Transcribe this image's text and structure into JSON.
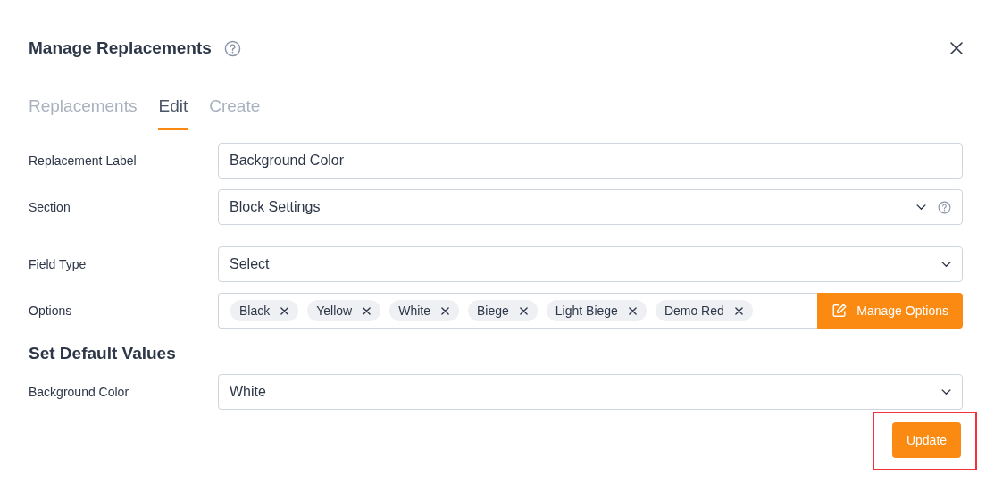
{
  "dialog": {
    "title": "Manage Replacements",
    "has_help": true
  },
  "tabs": [
    {
      "label": "Replacements",
      "selected": false
    },
    {
      "label": "Edit",
      "selected": true
    },
    {
      "label": "Create",
      "selected": false
    }
  ],
  "fields": [
    {
      "kind": "text",
      "label": "Replacement Label",
      "value": "Background Color"
    },
    {
      "kind": "select",
      "label": "Section",
      "value": "Block Settings",
      "has_help": true
    },
    {
      "kind": "select",
      "label": "Field Type",
      "value": "Select",
      "has_help": false
    },
    {
      "kind": "tags",
      "label": "Options",
      "tags": [
        "Black",
        "Yellow",
        "White",
        "Biege",
        "Light Biege",
        "Demo Red"
      ],
      "button": "Manage Options"
    }
  ],
  "defaults": {
    "heading": "Set Default Values",
    "fields": [
      {
        "kind": "select",
        "label": "Background Color",
        "value": "White",
        "has_help": false
      }
    ]
  },
  "update_button": {
    "label": "Update",
    "highlighted": true
  }
}
